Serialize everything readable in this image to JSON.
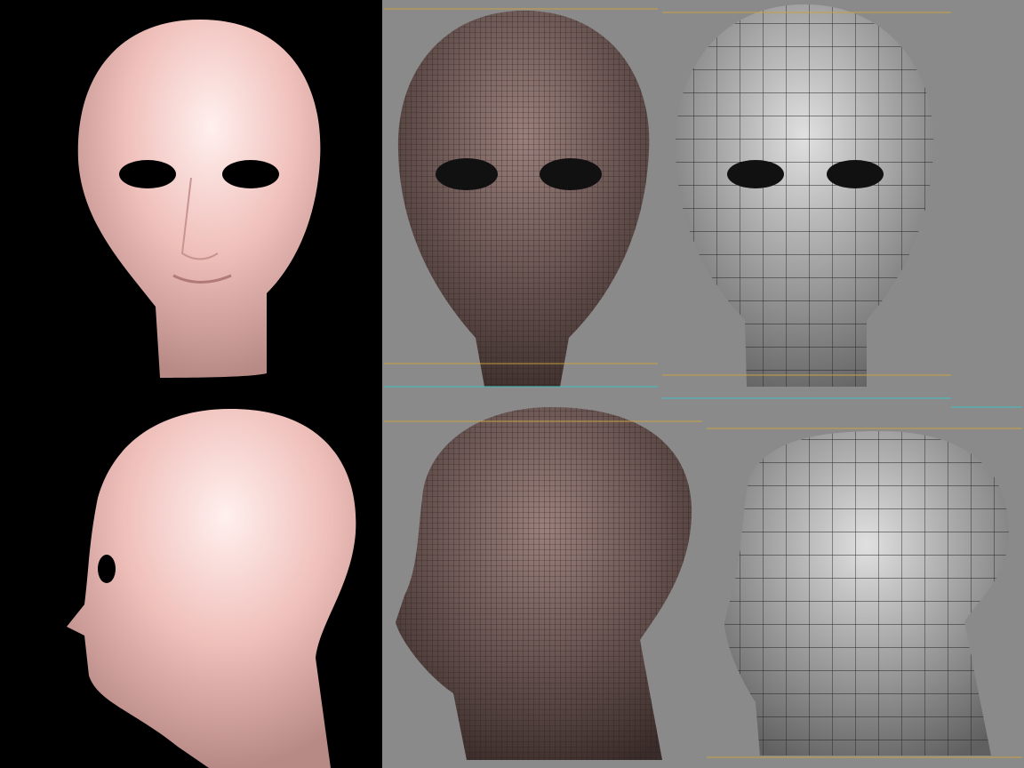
{
  "colors": {
    "render_background": "#000000",
    "viewport_background": "#8a8a8a",
    "skin": "#f2c4bf",
    "mesh_dense": "#5a4440",
    "mesh_low": "#c8c8c8",
    "guide_orange": "#c8a040",
    "guide_cyan": "#40c0c0"
  },
  "panels": [
    {
      "name": "render-front"
    },
    {
      "name": "render-side"
    },
    {
      "name": "wireframe-dense-front"
    },
    {
      "name": "wireframe-low-front"
    },
    {
      "name": "wireframe-dense-side"
    },
    {
      "name": "wireframe-low-side"
    }
  ]
}
